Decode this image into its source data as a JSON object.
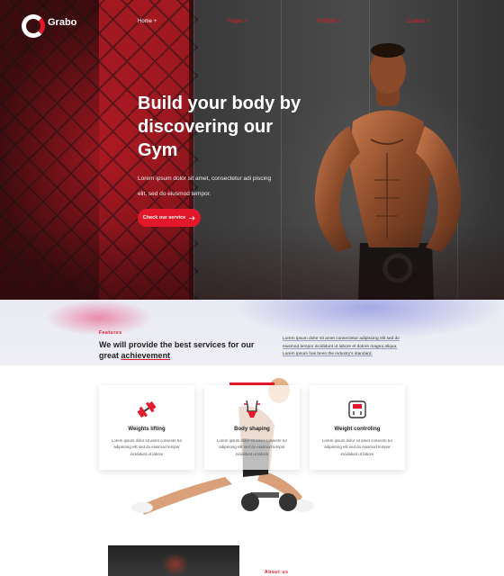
{
  "brand": {
    "name": "Grabo",
    "accent": "#e3172a"
  },
  "nav": {
    "items": [
      {
        "label": "Home +"
      },
      {
        "label": "Pages +"
      },
      {
        "label": "Portfolio +"
      },
      {
        "label": "Contact +"
      }
    ]
  },
  "hero": {
    "title": "Build your body by discovering our Gym",
    "description": "Lorem ipsum dolor sit amet, consectetur adi piscing elit, sed do eiusmod tempor.",
    "button_label": "Check our service",
    "button_icon": "arrow-right-icon"
  },
  "features": {
    "label": "Features",
    "title_main": "We will provide the best services for our great",
    "title_highlight": "achievement",
    "description": "Lorem ipsum dolor sit amet consectetur adipiscing elit sed do eiusmod tempor incididunt ut labore et dolore magna aliqua. Lorem Ipsum has been the industry's standard."
  },
  "cards": [
    {
      "title": "Weights lifting",
      "icon": "dumbbell-icon",
      "text": "Lorem ipsum dolor sit amet consecte tur adipiscing elit sed do eiusmod tempor incididunt ut labore"
    },
    {
      "title": "Body shaping",
      "icon": "body-shape-icon",
      "text": "Lorem ipsum dolor sit amet consecte tur adipiscing elit sed do eiusmod tempor incididunt ut labore"
    },
    {
      "title": "Weight controling",
      "icon": "scale-icon",
      "text": "Lorem ipsum dolor sit amet consecte tur adipiscing elit sed do eiusmod tempor incididunt ut labore"
    }
  ],
  "about": {
    "label": "About us"
  }
}
